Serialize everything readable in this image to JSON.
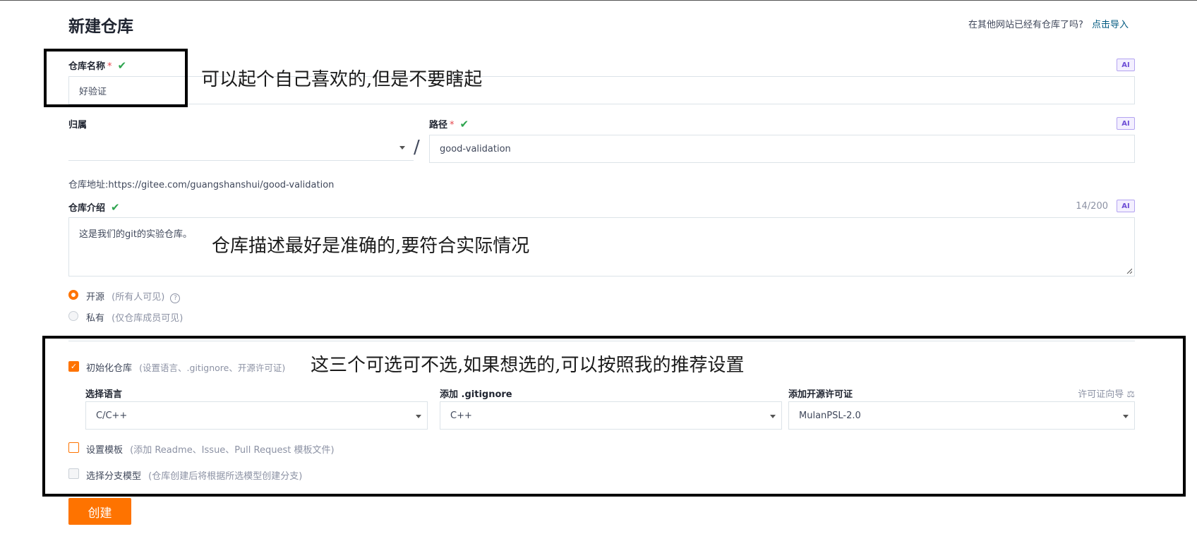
{
  "page": {
    "title": "新建仓库",
    "import_prompt": "在其他网站已经有仓库了吗?",
    "import_link": "点击导入"
  },
  "repo_name": {
    "label": "仓库名称",
    "required_mark": "*",
    "value": "好验证",
    "ai_label": "AI"
  },
  "owner": {
    "label": "归属",
    "value": ""
  },
  "path": {
    "separator": "/",
    "label": "路径",
    "required_mark": "*",
    "value": "good-validation",
    "ai_label": "AI"
  },
  "repo_url": {
    "label": "仓库地址:",
    "value": "https://gitee.com/guangshanshui/good-validation"
  },
  "description": {
    "label": "仓库介绍",
    "counter": "14/200",
    "ai_label": "AI",
    "value": "这是我们的git的实验仓库。"
  },
  "visibility": {
    "options": [
      {
        "label": "开源",
        "hint": "(所有人可见)",
        "selected": true
      },
      {
        "label": "私有",
        "hint": "(仅仓库成员可见)",
        "selected": false
      }
    ]
  },
  "init": {
    "label": "初始化仓库",
    "hint": "(设置语言、.gitignore、开源许可证)",
    "checked": true,
    "language": {
      "label": "选择语言",
      "value": "C/C++"
    },
    "gitignore": {
      "label": "添加 .gitignore",
      "value": "C++"
    },
    "license": {
      "label": "添加开源许可证",
      "value": "MulanPSL-2.0",
      "guide": "许可证向导"
    }
  },
  "template": {
    "label": "设置模板",
    "hint": "(添加 Readme、Issue、Pull Request 模板文件)",
    "checked": false
  },
  "branch_model": {
    "label": "选择分支模型",
    "hint": "(仓库创建后将根据所选模型创建分支)",
    "checked": false
  },
  "submit": {
    "label": "创建"
  },
  "annotations": {
    "name_note": "可以起个自己喜欢的,但是不要瞎起",
    "desc_note": "仓库描述最好是准确的,要符合实际情况",
    "init_note": "这三个可选可不选,如果想选的,可以按照我的推荐设置"
  },
  "colors": {
    "accent": "#fe7300",
    "link": "#005980",
    "success": "#2da44e",
    "ai_badge": "#6f4fd6"
  }
}
